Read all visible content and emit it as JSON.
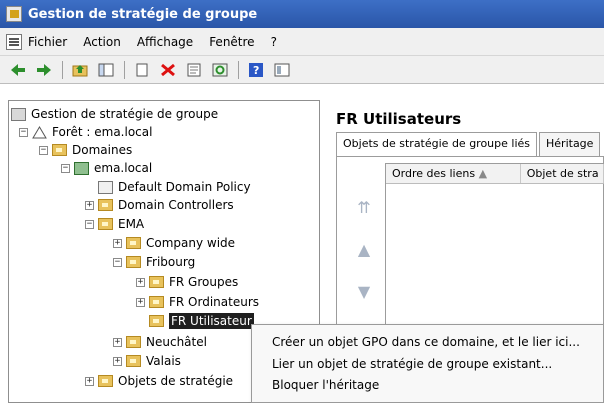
{
  "window": {
    "title": "Gestion de stratégie de groupe"
  },
  "menu": [
    "Fichier",
    "Action",
    "Affichage",
    "Fenêtre",
    "?"
  ],
  "toolbar": [
    "back-icon",
    "forward-icon",
    "up-folder-icon",
    "show-hide-tree-icon",
    "copy-icon",
    "delete-icon",
    "properties-icon",
    "refresh-icon",
    "help-icon",
    "view-icon"
  ],
  "tree": {
    "root": "Gestion de stratégie de groupe",
    "forest": "Forêt : ema.local",
    "domains": "Domaines",
    "domain": "ema.local",
    "default_policy": "Default Domain Policy",
    "domain_controllers": "Domain Controllers",
    "ema": "EMA",
    "company_wide": "Company wide",
    "fribourg": "Fribourg",
    "fr_groupes": "FR Groupes",
    "fr_ordinateurs": "FR Ordinateurs",
    "fr_utilisateurs": "FR Utilisateur",
    "neuchatel": "Neuchâtel",
    "valais": "Valais",
    "objets_strategie": "Objets de stratégie"
  },
  "panel": {
    "title": "FR Utilisateurs",
    "tabs": [
      "Objets de stratégie de groupe liés",
      "Héritage"
    ],
    "columns": [
      "Ordre des liens",
      "Objet de stra"
    ]
  },
  "context_menu": [
    "Créer un objet GPO dans ce domaine, et le lier ici...",
    "Lier un objet de stratégie de groupe existant...",
    "Bloquer l'héritage"
  ],
  "colors": {
    "titlebar": "#2f5fb7",
    "highlight": "#ffff00",
    "selection": "#1f1f1f"
  }
}
